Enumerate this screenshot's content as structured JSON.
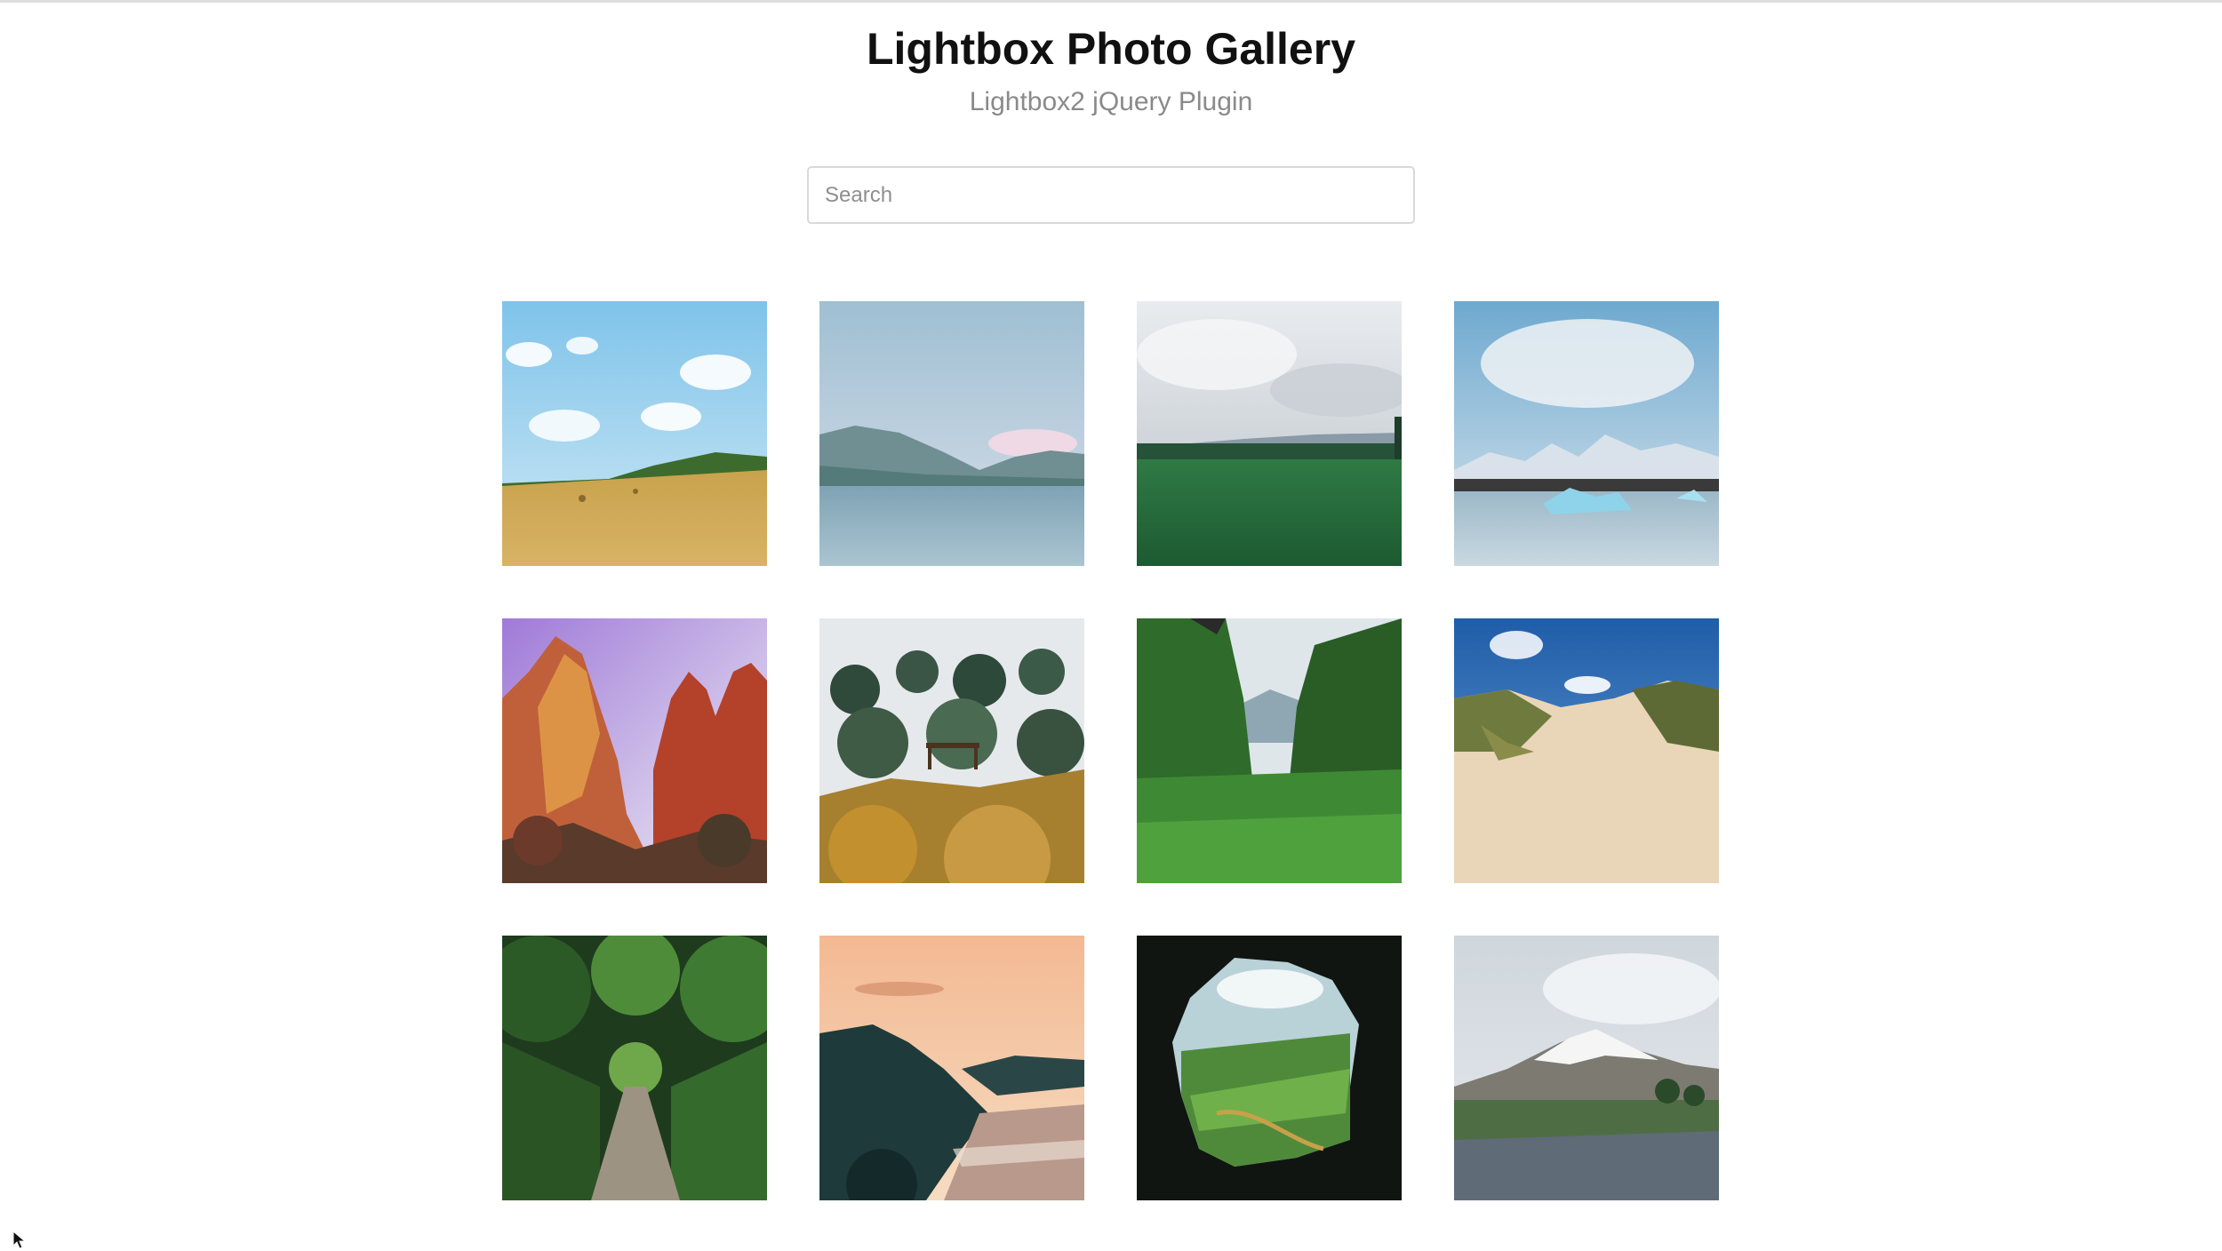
{
  "header": {
    "title": "Lightbox Photo Gallery",
    "subtitle": "Lightbox2 jQuery Plugin"
  },
  "search": {
    "placeholder": "Search",
    "value": ""
  },
  "gallery": {
    "photos": [
      {
        "scene": "wheat-field-blue-sky"
      },
      {
        "scene": "mountain-lake-pastel"
      },
      {
        "scene": "green-meadow-cloudy"
      },
      {
        "scene": "glacier-lagoon-icebergs"
      },
      {
        "scene": "red-rock-canyon"
      },
      {
        "scene": "forest-garden-bridge"
      },
      {
        "scene": "green-valley-trees"
      },
      {
        "scene": "sand-dunes-blue-sky"
      },
      {
        "scene": "forest-path-tunnel"
      },
      {
        "scene": "coastline-sunset"
      },
      {
        "scene": "cave-opening-valley"
      },
      {
        "scene": "snowy-mountain-lupine-field"
      }
    ]
  },
  "colors": {
    "title": "#111111",
    "subtitle": "#8a8a8a",
    "search_border": "#d9d9d9"
  }
}
